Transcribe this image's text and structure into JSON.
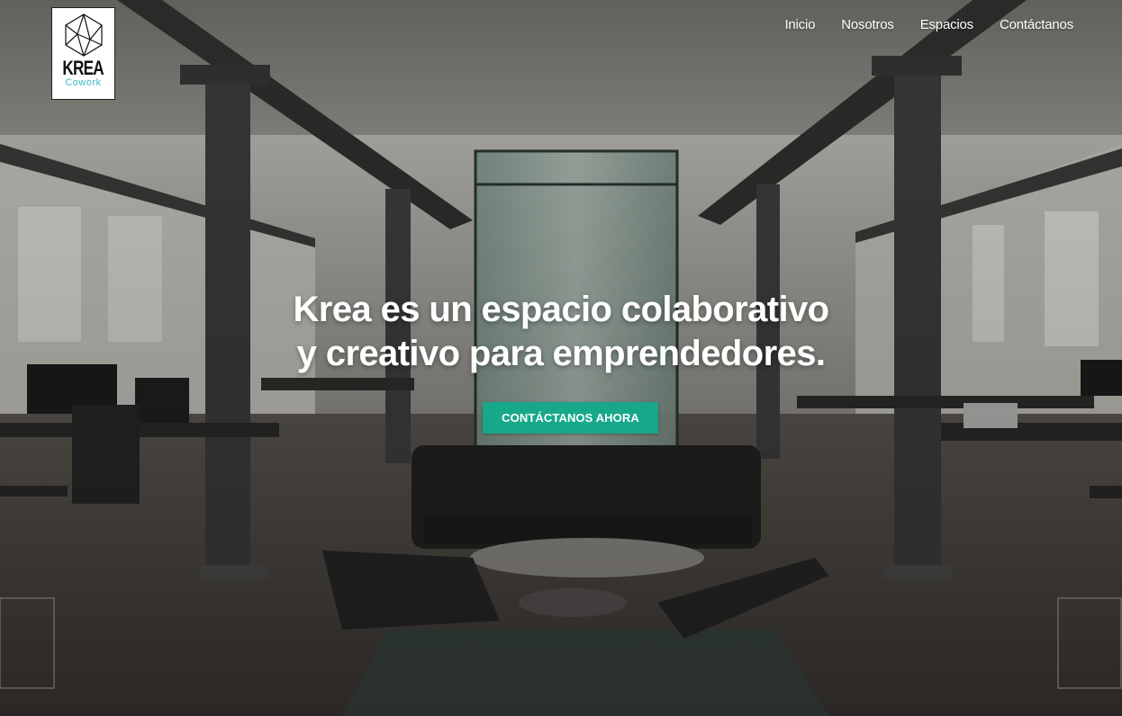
{
  "brand": {
    "logo_word": "KREA",
    "logo_sub": "Cowork"
  },
  "nav": {
    "items": [
      "Inicio",
      "Nosotros",
      "Espacios",
      "Contáctanos"
    ]
  },
  "hero": {
    "title_line1": "Krea es un espacio colaborativo",
    "title_line2": "y creativo para emprendedores.",
    "cta_label": "CONTÁCTANOS AHORA"
  },
  "colors": {
    "cta": "#17a88a",
    "logo_accent": "#3fb7c7"
  }
}
